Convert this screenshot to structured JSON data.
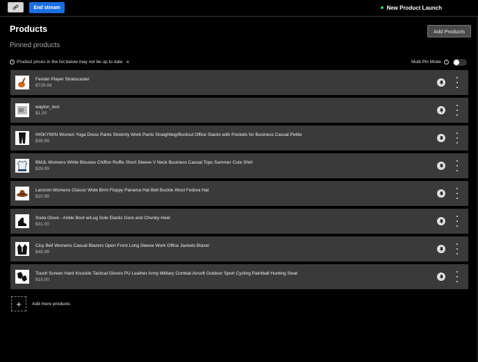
{
  "topbar": {
    "end_stream_label": "End stream",
    "stream_title": "New Product Launch",
    "live_color": "#2ecc71",
    "accent_color": "#1a6fe0"
  },
  "header": {
    "title": "Products",
    "add_products_label": "Add Products"
  },
  "section": {
    "title": "Pinned products",
    "notice": "Product prices in the list below may not be up to date",
    "multi_pin_label": "Multi Pin Mode",
    "multi_pin_on": false
  },
  "products": [
    {
      "name": "Fender Player Stratocaster",
      "price": "$729.99",
      "icon": "guitar-thumbnail"
    },
    {
      "name": "waylon_test",
      "price": "$1.00",
      "icon": "test-thumbnail"
    },
    {
      "name": "HISKYWIN Women Yoga Dress Pants Stretchy Work Pants Straightleg/Bootcut Office Slacks with Pockets for Business Casual Petite",
      "price": "$38.99",
      "icon": "pants-thumbnail"
    },
    {
      "name": "BMJL Womens White Blouses Chiffon Ruffle Short Sleeve V Neck Business Casual Tops Summer Cute Shirt",
      "price": "$28.99",
      "icon": "blouse-thumbnail"
    },
    {
      "name": "Lanzom Womens Classic Wide Brim Floppy Panama Hat Belt Buckle Wool Fedora Hat",
      "price": "$20.99",
      "icon": "hat-thumbnail"
    },
    {
      "name": "Soda Glove - Ankle Boot w/Lug Sole Elastic Gore and Chunky Heel",
      "price": "$31.00",
      "icon": "boot-thumbnail"
    },
    {
      "name": "Cicy Bell Womens Casual Blazers Open Front Long Sleeve Work Office Jackets Blazer",
      "price": "$49.99",
      "icon": "blazer-thumbnail"
    },
    {
      "name": "Touch Screen Hard Knuckle Tactical Gloves PU Leather Army Military Combat Airsoft Outdoor Sport Cycling Paintball Hunting Swat",
      "price": "$15.00",
      "icon": "gloves-thumbnail"
    }
  ],
  "footer": {
    "add_more_label": "Add more products"
  }
}
